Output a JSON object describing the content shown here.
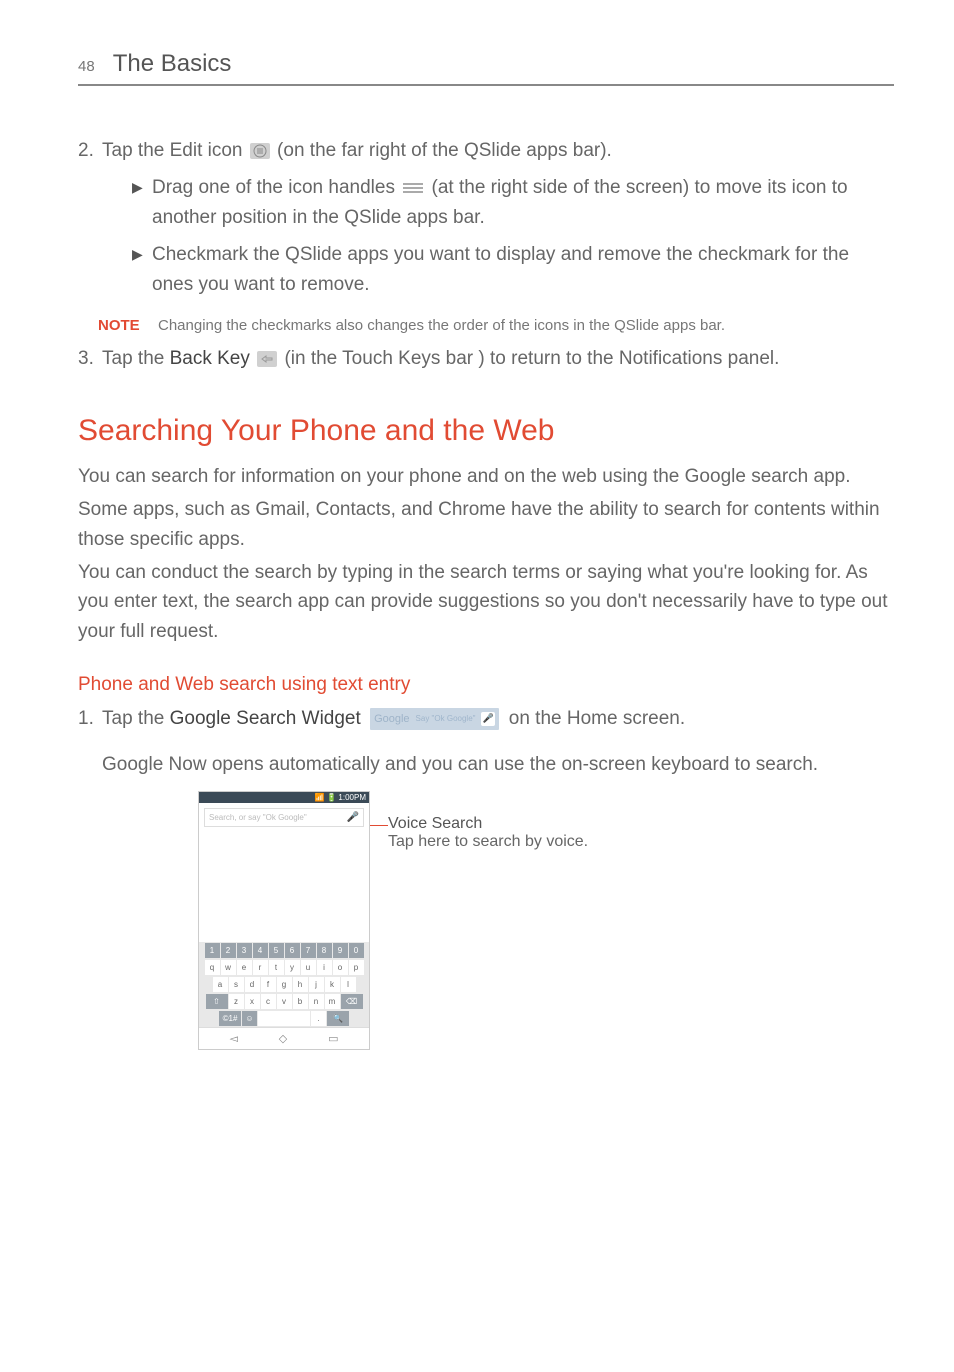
{
  "header": {
    "page_number": "48",
    "title": "The Basics"
  },
  "step2": {
    "num": "2.",
    "text_before": "Tap the Edit icon ",
    "text_after": " (on the far right of the QSlide apps bar).",
    "bullets": [
      {
        "before": "Drag one of the icon handles ",
        "after": " (at the right side of the screen) to move its icon to another position in the QSlide apps bar."
      },
      {
        "text": "Checkmark the QSlide apps you want to display and remove the checkmark for the ones you want to remove."
      }
    ]
  },
  "note": {
    "label": "NOTE",
    "text": "Changing the checkmarks also changes the order of the icons in the QSlide apps bar."
  },
  "step3": {
    "num": "3.",
    "before": "Tap the ",
    "bold": "Back Key",
    "after": " (in the Touch Keys bar ) to return to the Notifications panel."
  },
  "h1": "Searching Your Phone and the Web",
  "paras": [
    "You can search for information on your phone and on the web using the Google search app.",
    "Some apps, such as Gmail, Contacts, and Chrome have the ability to search for contents within those specific apps.",
    "You can conduct the search by typing in the search terms or saying what you're looking for. As you enter text, the search app can provide suggestions so you don't necessarily have to type out your full request."
  ],
  "h3": "Phone and Web search using text entry",
  "step1b": {
    "num": "1.",
    "before": "Tap the ",
    "bold": "Google Search Widget",
    "widget": {
      "google": "Google",
      "say": "Say \"Ok Google\""
    },
    "after": " on the Home screen.",
    "para2": "Google Now opens automatically and you can use the on-screen keyboard to search."
  },
  "phone": {
    "status_time": "1:00PM",
    "search_placeholder": "Search, or say \"Ok Google\"",
    "num_row": [
      "1",
      "2",
      "3",
      "4",
      "5",
      "6",
      "7",
      "8",
      "9",
      "0"
    ],
    "row1": [
      "q",
      "w",
      "e",
      "r",
      "t",
      "y",
      "u",
      "i",
      "o",
      "p"
    ],
    "row2": [
      "a",
      "s",
      "d",
      "f",
      "g",
      "h",
      "j",
      "k",
      "l"
    ],
    "row3_shift": "⇧",
    "row3": [
      "z",
      "x",
      "c",
      "v",
      "b",
      "n",
      "m"
    ],
    "row3_del": "⌫",
    "row4_sym": "©1#",
    "row4_emoji": "☺",
    "row4_dot": ".",
    "row4_search": "🔍",
    "nav_back": "◅",
    "nav_home": "◇",
    "nav_recent": "▭"
  },
  "callout": {
    "title": "Voice Search",
    "text": "Tap here to search by voice."
  }
}
